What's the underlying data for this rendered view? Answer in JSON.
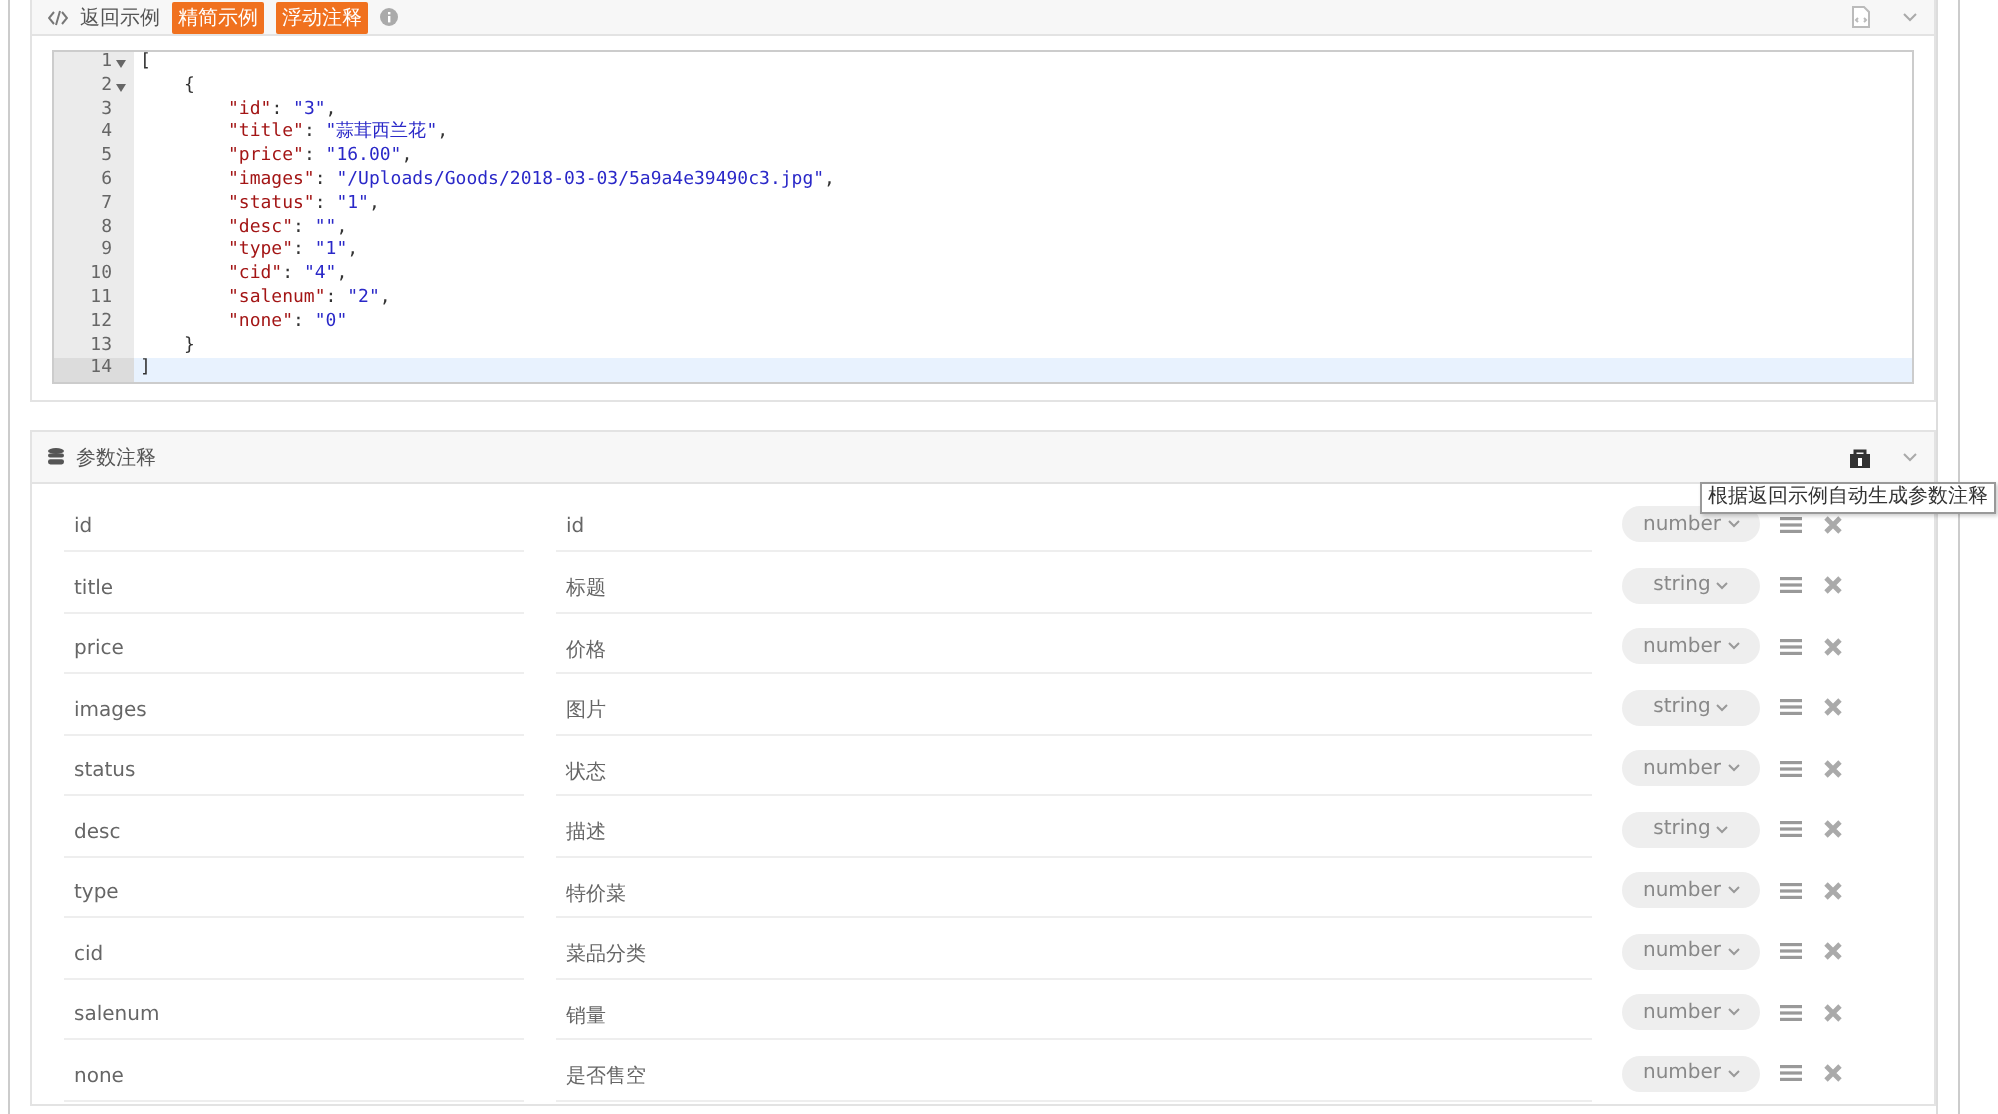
{
  "example_panel": {
    "title": "返回示例",
    "tags": [
      "精简示例",
      "浮动注释"
    ],
    "code_lines": [
      {
        "number": "1",
        "kind": "array",
        "fold": true,
        "active": false,
        "tokens": [
          {
            "kind": "punct",
            "text": "["
          }
        ]
      },
      {
        "number": "2",
        "kind": "object",
        "fold": true,
        "active": false,
        "tokens": [
          {
            "kind": "punct",
            "text": "{"
          }
        ]
      },
      {
        "number": "3",
        "kind": "member",
        "fold": false,
        "active": false,
        "tokens": [
          {
            "kind": "key",
            "text": "\"id\""
          },
          {
            "kind": "punct",
            "text": ": "
          },
          {
            "kind": "string",
            "text": "\"3\""
          },
          {
            "kind": "punct",
            "text": ","
          }
        ]
      },
      {
        "number": "4",
        "kind": "member",
        "fold": false,
        "active": false,
        "tokens": [
          {
            "kind": "key",
            "text": "\"title\""
          },
          {
            "kind": "punct",
            "text": ": "
          },
          {
            "kind": "string",
            "text": "\"蒜茸西兰花\""
          },
          {
            "kind": "punct",
            "text": ","
          }
        ]
      },
      {
        "number": "5",
        "kind": "member",
        "fold": false,
        "active": false,
        "tokens": [
          {
            "kind": "key",
            "text": "\"price\""
          },
          {
            "kind": "punct",
            "text": ": "
          },
          {
            "kind": "string",
            "text": "\"16.00\""
          },
          {
            "kind": "punct",
            "text": ","
          }
        ]
      },
      {
        "number": "6",
        "kind": "member",
        "fold": false,
        "active": false,
        "tokens": [
          {
            "kind": "key",
            "text": "\"images\""
          },
          {
            "kind": "punct",
            "text": ": "
          },
          {
            "kind": "string",
            "text": "\"/Uploads/Goods/2018-03-03/5a9a4e39490c3.jpg\""
          },
          {
            "kind": "punct",
            "text": ","
          }
        ]
      },
      {
        "number": "7",
        "kind": "member",
        "fold": false,
        "active": false,
        "tokens": [
          {
            "kind": "key",
            "text": "\"status\""
          },
          {
            "kind": "punct",
            "text": ": "
          },
          {
            "kind": "string",
            "text": "\"1\""
          },
          {
            "kind": "punct",
            "text": ","
          }
        ]
      },
      {
        "number": "8",
        "kind": "member",
        "fold": false,
        "active": false,
        "tokens": [
          {
            "kind": "key",
            "text": "\"desc\""
          },
          {
            "kind": "punct",
            "text": ": "
          },
          {
            "kind": "string",
            "text": "\"\""
          },
          {
            "kind": "punct",
            "text": ","
          }
        ]
      },
      {
        "number": "9",
        "kind": "member",
        "fold": false,
        "active": false,
        "tokens": [
          {
            "kind": "key",
            "text": "\"type\""
          },
          {
            "kind": "punct",
            "text": ": "
          },
          {
            "kind": "string",
            "text": "\"1\""
          },
          {
            "kind": "punct",
            "text": ","
          }
        ]
      },
      {
        "number": "10",
        "kind": "member",
        "fold": false,
        "active": false,
        "tokens": [
          {
            "kind": "key",
            "text": "\"cid\""
          },
          {
            "kind": "punct",
            "text": ": "
          },
          {
            "kind": "string",
            "text": "\"4\""
          },
          {
            "kind": "punct",
            "text": ","
          }
        ]
      },
      {
        "number": "11",
        "kind": "member",
        "fold": false,
        "active": false,
        "tokens": [
          {
            "kind": "key",
            "text": "\"salenum\""
          },
          {
            "kind": "punct",
            "text": ": "
          },
          {
            "kind": "string",
            "text": "\"2\""
          },
          {
            "kind": "punct",
            "text": ","
          }
        ]
      },
      {
        "number": "12",
        "kind": "member",
        "fold": false,
        "active": false,
        "tokens": [
          {
            "kind": "key",
            "text": "\"none\""
          },
          {
            "kind": "punct",
            "text": ": "
          },
          {
            "kind": "string",
            "text": "\"0\""
          }
        ]
      },
      {
        "number": "13",
        "kind": "object",
        "fold": false,
        "active": false,
        "tokens": [
          {
            "kind": "punct",
            "text": "}"
          }
        ]
      },
      {
        "number": "14",
        "kind": "array",
        "fold": false,
        "active": true,
        "tokens": [
          {
            "kind": "punct",
            "text": "]"
          }
        ]
      }
    ]
  },
  "params_panel": {
    "title": "参数注释",
    "tooltip": "根据返回示例自动生成参数注释",
    "rows": [
      {
        "name": "id",
        "comment": "id",
        "type": "number"
      },
      {
        "name": "title",
        "comment": "标题",
        "type": "string"
      },
      {
        "name": "price",
        "comment": "价格",
        "type": "number"
      },
      {
        "name": "images",
        "comment": "图片",
        "type": "string"
      },
      {
        "name": "status",
        "comment": "状态",
        "type": "number"
      },
      {
        "name": "desc",
        "comment": "描述",
        "type": "string"
      },
      {
        "name": "type",
        "comment": "特价菜",
        "type": "number"
      },
      {
        "name": "cid",
        "comment": "菜品分类",
        "type": "number"
      },
      {
        "name": "salenum",
        "comment": "销量",
        "type": "number"
      },
      {
        "name": "none",
        "comment": "是否售空",
        "type": "number"
      }
    ]
  }
}
